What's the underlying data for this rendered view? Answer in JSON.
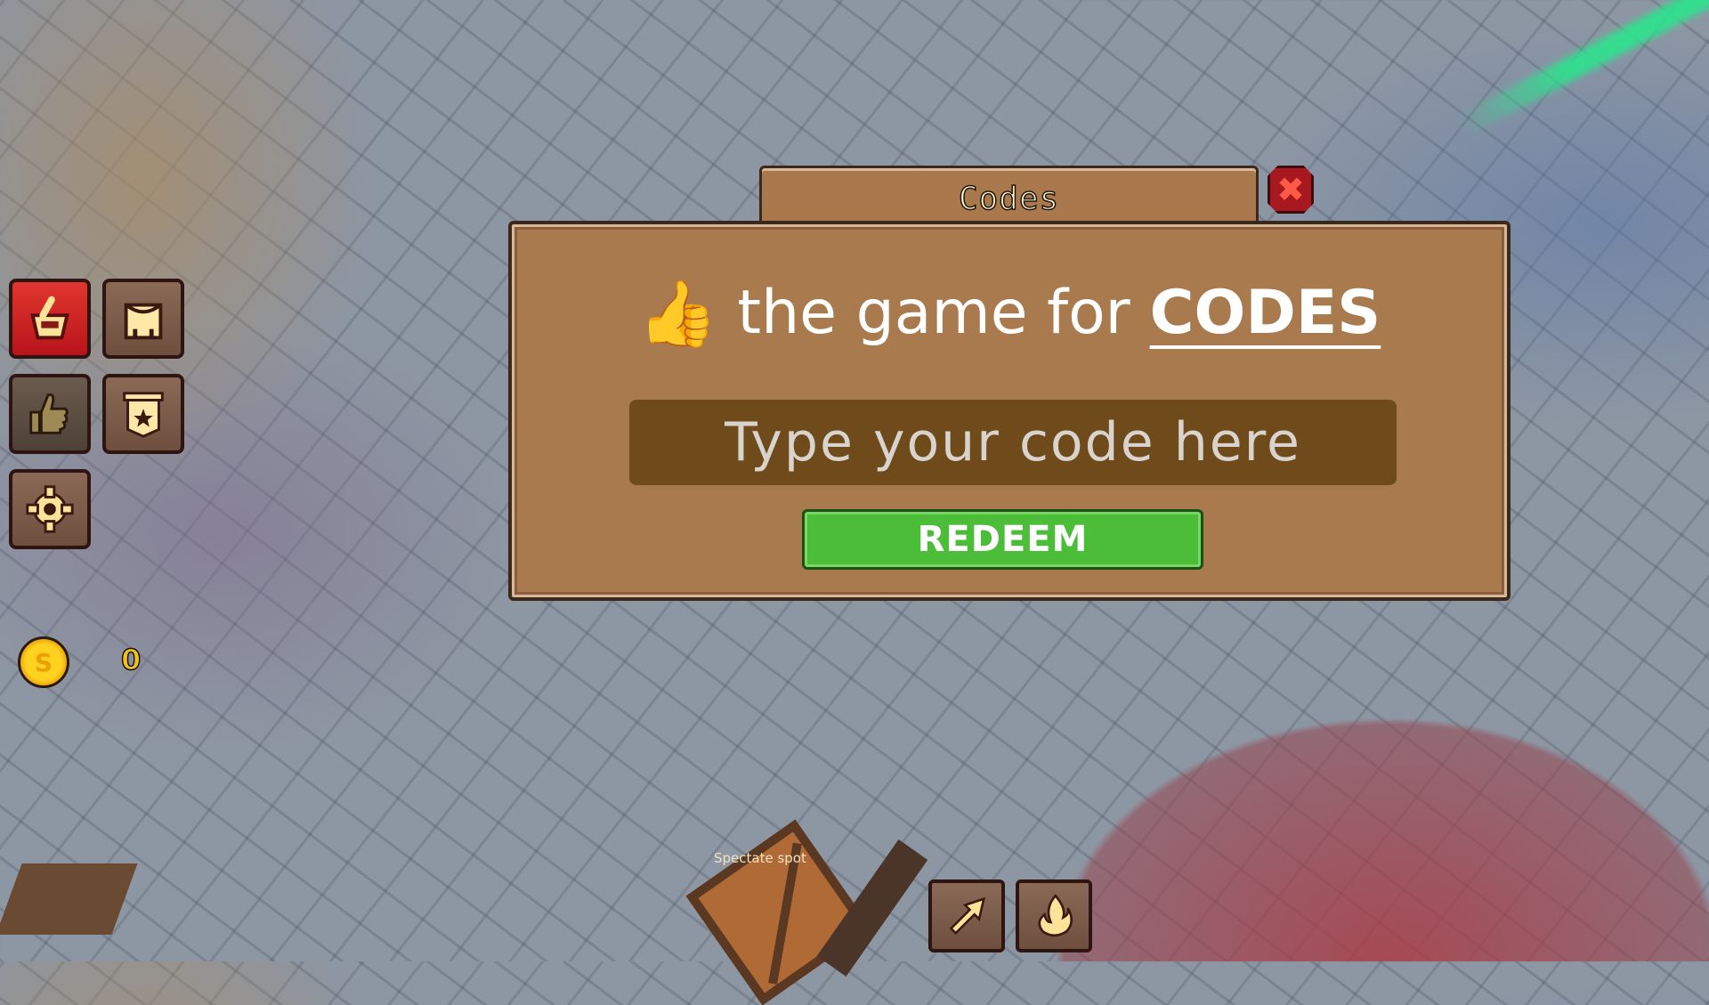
{
  "dialog": {
    "title": "Codes",
    "close_icon": "close-x-icon",
    "heading_icon": "thumbs-up-icon",
    "heading_emoji": "👍",
    "heading_text": "the game for",
    "heading_emphasis": "CODES",
    "input": {
      "value": "",
      "placeholder": "Type your code here"
    },
    "redeem_label": "REDEEM"
  },
  "left_menu": {
    "items": [
      {
        "name": "shop",
        "icon": "shopping-basket-icon"
      },
      {
        "name": "inventory",
        "icon": "backpack-icon"
      },
      {
        "name": "codes",
        "icon": "thumbs-up-icon"
      },
      {
        "name": "rewards",
        "icon": "banner-star-icon"
      },
      {
        "name": "settings",
        "icon": "gear-icon"
      }
    ]
  },
  "currency": {
    "icon": "coin-icon",
    "symbol": "S",
    "amount": "0"
  },
  "world": {
    "spectate_label": "Spectate spot"
  },
  "abilities": [
    {
      "name": "dash",
      "icon": "arrow-dash-icon"
    },
    {
      "name": "fire",
      "icon": "flame-icon"
    }
  ],
  "colors": {
    "panel": "#a87a4e",
    "panel_border": "#3a2a1d",
    "input_bg": "#6f4a1a",
    "redeem": "#4cbd38",
    "close": "#a8191f",
    "coin": "#ffd21f"
  }
}
